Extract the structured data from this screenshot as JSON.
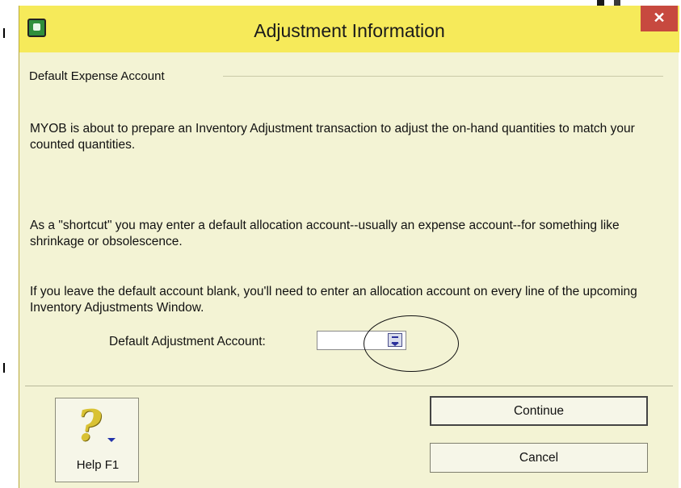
{
  "window": {
    "title": "Adjustment Information",
    "close_glyph": "✕"
  },
  "group": {
    "label": "Default Expense Account"
  },
  "paragraphs": {
    "p1": "MYOB is about to prepare an Inventory Adjustment transaction to adjust the on-hand quantities to match your counted quantities.",
    "p2": "As a \"shortcut\" you may enter a default allocation account--usually an expense account--for something like shrinkage or obsolescence.",
    "p3": "If you leave the default account blank, you'll need to enter an allocation account on every line of the upcoming Inventory Adjustments Window."
  },
  "account_field": {
    "label": "Default Adjustment Account:",
    "value": ""
  },
  "buttons": {
    "help": "Help F1",
    "continue": "Continue",
    "cancel": "Cancel"
  },
  "icons": {
    "app": "myob-app-icon",
    "help": "question-mark-icon",
    "list": "list-lookup-icon"
  },
  "colors": {
    "titlebar": "#f6ea5a",
    "window_bg": "#f3f3d4",
    "close": "#c7493f"
  }
}
